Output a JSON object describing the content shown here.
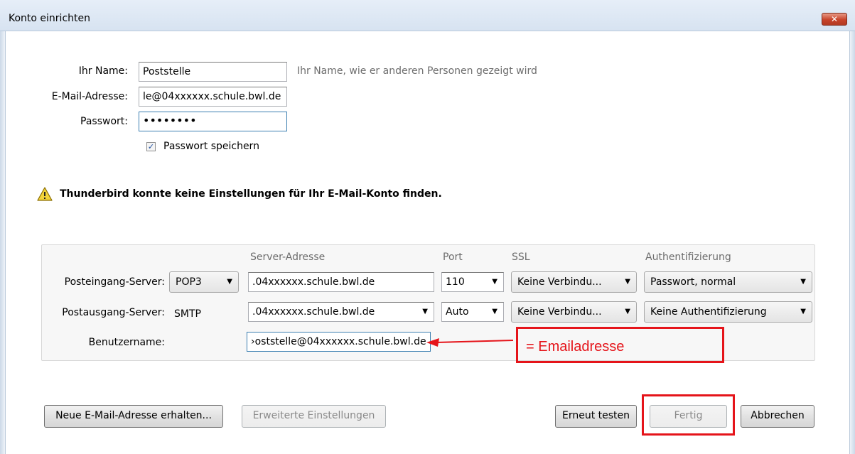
{
  "window": {
    "title": "Konto einrichten",
    "close_symbol": "✕"
  },
  "form": {
    "name_label": "Ihr Name:",
    "name_value": "Poststelle",
    "name_hint": "Ihr Name, wie er anderen Personen gezeigt wird",
    "email_label": "E-Mail-Adresse:",
    "email_value": "le@04xxxxxx.schule.bwl.de",
    "password_label": "Passwort:",
    "password_value": "••••••••",
    "save_password_label": "Passwort speichern",
    "save_password_checked": true
  },
  "warning": {
    "icon": "warning-icon",
    "text": "Thunderbird konnte keine Einstellungen für Ihr E-Mail-Konto finden."
  },
  "server": {
    "headers": {
      "address": "Server-Adresse",
      "port": "Port",
      "ssl": "SSL",
      "auth": "Authentifizierung"
    },
    "incoming": {
      "label": "Posteingang-Server:",
      "protocol": "POP3",
      "address": ".04xxxxxx.schule.bwl.de",
      "port": "110",
      "ssl": "Keine Verbindu...",
      "auth": "Passwort, normal"
    },
    "outgoing": {
      "label": "Postausgang-Server:",
      "protocol": "SMTP",
      "address": ".04xxxxxx.schule.bwl.de",
      "port": "Auto",
      "ssl": "Keine Verbindu...",
      "auth": "Keine Authentifizierung"
    },
    "username": {
      "label": "Benutzername:",
      "value": "›oststelle@04xxxxxx.schule.bwl.de"
    }
  },
  "annotation": {
    "text": "= Emailadresse",
    "color": "#e5141a"
  },
  "buttons": {
    "new_address": "Neue E-Mail-Adresse erhalten...",
    "advanced": "Erweiterte Einstellungen",
    "retest": "Erneut testen",
    "done": "Fertig",
    "cancel": "Abbrechen"
  }
}
